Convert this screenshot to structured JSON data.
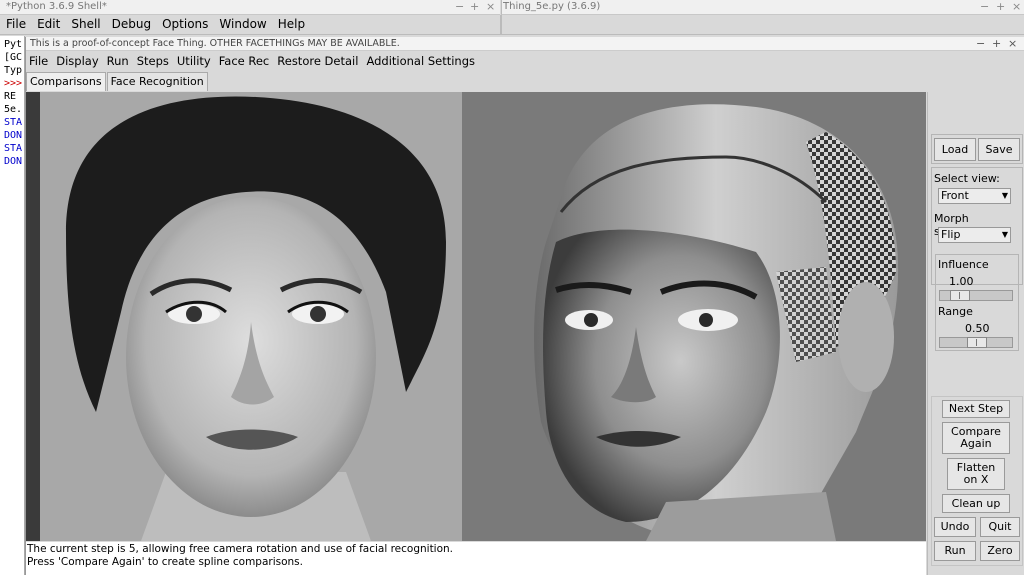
{
  "shell_window": {
    "title": "*Python 3.6.9 Shell*",
    "menu": [
      "File",
      "Edit",
      "Shell",
      "Debug",
      "Options",
      "Window",
      "Help"
    ],
    "lines": [
      "Pyt",
      "[GC",
      "Typ",
      ">>>",
      " RE",
      "5e.",
      "STA",
      "DON",
      "STA",
      "DON"
    ]
  },
  "editor_window": {
    "title": "Thing_5e.py (3.6.9)"
  },
  "app": {
    "title": "This is a proof-of-concept Face Thing.  OTHER FACETHINGs MAY BE AVAILABLE.",
    "menu": [
      "File",
      "Display",
      "Run",
      "Steps",
      "Utility",
      "Face Rec",
      "Restore Detail",
      "Additional Settings"
    ],
    "tabs": [
      "Comparisons",
      "Face Recognition"
    ],
    "status_lines": [
      "The current step is 5, allowing free camera rotation and use of facial recognition.",
      "Press 'Compare Again' to create spline comparisons."
    ]
  },
  "panel": {
    "load": "Load",
    "save": "Save",
    "select_view_label": "Select view:",
    "select_view_value": "Front",
    "morph_symmetry_label": "Morph symmetry:",
    "morph_symmetry_value": "Flip",
    "influence_label": "Influence",
    "influence_value": "1.00",
    "range_label": "Range",
    "range_value": "0.50",
    "next_step": "Next Step",
    "compare_again_1": "Compare",
    "compare_again_2": "Again",
    "flatten_1": "Flatten",
    "flatten_2": "on X",
    "clean_up": "Clean up",
    "undo": "Undo",
    "quit": "Quit",
    "run": "Run",
    "zero": "Zero"
  },
  "window_controls": {
    "minimize": "−",
    "maximize": "+",
    "close": "×"
  }
}
